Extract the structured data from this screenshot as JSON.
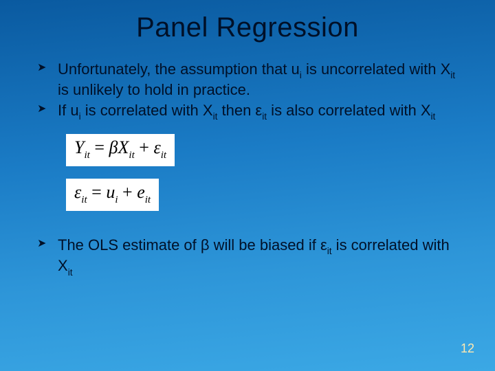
{
  "title": "Panel Regression",
  "bullets": {
    "b1": {
      "t1": "Unfortunately, the assumption that u",
      "s1": "i",
      "t2": " is uncorrelated with X",
      "s2": "it",
      "t3": " is unlikely to hold in practice."
    },
    "b2": {
      "t1": "If u",
      "s1": "i",
      "t2": " is correlated with X",
      "s2": "it",
      "t3": " then ε",
      "s3": "it",
      "t4": " is also correlated with X",
      "s4": "it"
    },
    "b3": {
      "t1": "The OLS estimate of β will be biased if ε",
      "s1": "it",
      "t2": " is correlated with X",
      "s2": "it"
    }
  },
  "equations": {
    "eq1": {
      "lhs": "Y",
      "lsub": "it",
      "eq": " = ",
      "c1": "β",
      "v1": "X",
      "v1s": "it",
      "plus": " + ",
      "c2": "ε",
      "c2s": "it"
    },
    "eq2": {
      "lhs": "ε",
      "lsub": "it",
      "eq": " = ",
      "v1": "u",
      "v1s": "i",
      "plus": " + ",
      "v2": "e",
      "v2s": "it"
    }
  },
  "page_number": "12"
}
